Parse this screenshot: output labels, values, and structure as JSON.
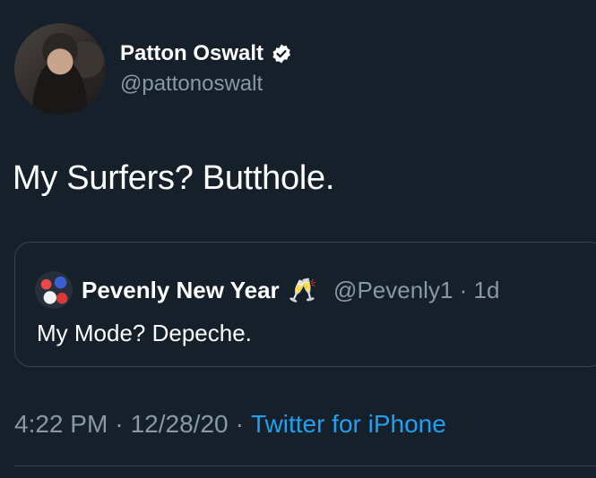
{
  "author": {
    "display_name": "Patton Oswalt",
    "handle": "@pattonoswalt",
    "verified": true,
    "verified_icon": "verified-badge-icon"
  },
  "tweet": {
    "text": "My Surfers? Butthole."
  },
  "quoted_tweet": {
    "display_name": "Pevenly New Year",
    "emoji": "🥂",
    "handle_time": "@Pevenly1 · 1d",
    "text": "My Mode? Depeche."
  },
  "meta": {
    "time": "4:22 PM",
    "separator": "·",
    "date": "12/28/20",
    "source": "Twitter for iPhone"
  },
  "colors": {
    "background": "#15202b",
    "secondary_text": "#8899a6",
    "link": "#1da1f2",
    "border": "#38444d"
  }
}
